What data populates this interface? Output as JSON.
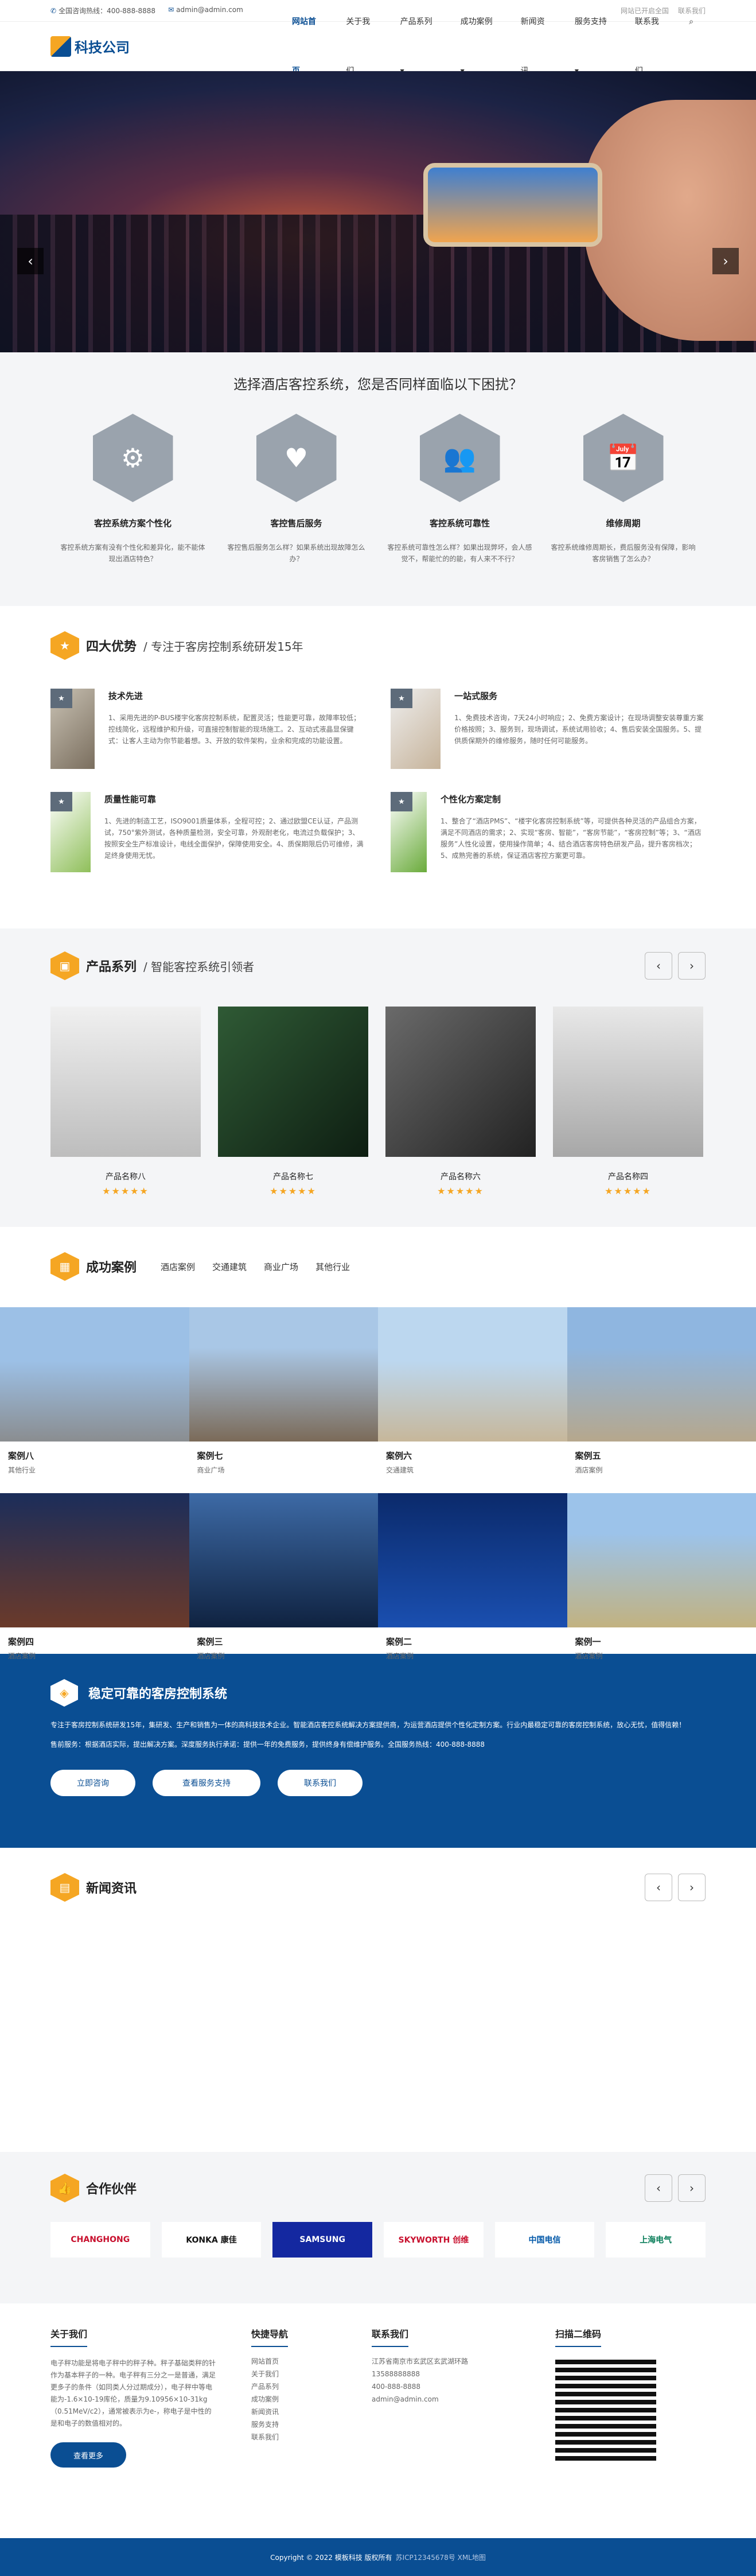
{
  "topbar": {
    "phone": "全国咨询热线：400-888-8888",
    "email": "admin@admin.com",
    "right1": "网站已开启全国",
    "right2": "联系我们"
  },
  "logo": {
    "name": "科技公司"
  },
  "menu": [
    "网站首页",
    "关于我们",
    "产品系列 ▾",
    "成功案例 ▾",
    "新闻资讯",
    "服务支持 ▾",
    "联系我们"
  ],
  "hero": {
    "prev": "‹",
    "next": "›"
  },
  "problems": {
    "title": "选择酒店客控系统，您是否同样面临以下困扰？",
    "items": [
      {
        "icon": "⚙",
        "t": "客控系统方案个性化",
        "d": "客控系统方案有没有个性化和差异化，能不能体现出酒店特色？"
      },
      {
        "icon": "♥",
        "t": "客控售后服务",
        "d": "客控售后服务怎么样？如果系统出现故障怎么办？"
      },
      {
        "icon": "👥",
        "t": "客控系统可靠性",
        "d": "客控系统可靠性怎么样？如果出现弊坏，会人感觉不，帮能忙的的能，有人来不不行？"
      },
      {
        "icon": "📅",
        "t": "维修周期",
        "d": "客控系统维修周期长，费后服务没有保障，影响客房销售了怎么办？"
      }
    ]
  },
  "advantages": {
    "title": "四大优势",
    "sub": "/ 专注于客房控制系统研发15年",
    "items": [
      {
        "t": "技术先进",
        "d": "1、采用先进的P-BUS楼宇化客房控制系统，配置灵活；性能更可靠，故障率较低；控线简化，远程维护和升级，可直接控制智能的现场施工。2、互动式液晶显保键式：让客人主动为你节能着想。3、开放的软件架构，业余和完成的功能设置。"
      },
      {
        "t": "一站式服务",
        "d": "1、免费技术咨询，7天24小时响应；2、免费方案设计；在现场调整安装尊重方案价格按照；3、服务到，现场调试，系统试用验收；4、售后安装全国服务。5、提供质保期外的维修服务，随时任何可能服务。"
      },
      {
        "t": "质量性能可靠",
        "d": "1、先进的制造工艺，ISO9001质量体系，全程可控；2、通过欧盟CE认证，产品测试，750°紫外测试，各种质量检测，安全可靠，外观耐老化，电流过负载保护；3、按照安全生产标准设计，电线全面保护，保障使用安全。4、质保期限后仍可维修，满足终身使用无忧。"
      },
      {
        "t": "个性化方案定制",
        "d": "1、整合了“酒店PMS”、“楼宇化客房控制系统”等，可提供各种灵活的产品组合方案，满足不同酒店的需求；2、实现“客房、智能”，“客房节能”，“客房控制”等；3、“酒店服务”人性化设置，使用操作简单；4、结合酒店客房特色研发产品，提升客房档次；5、成熟完善的系统，保证酒店客控方案更可靠。"
      }
    ]
  },
  "products": {
    "title": "产品系列",
    "sub": "/ 智能客控系统引领者",
    "items": [
      {
        "n": "产品名称八",
        "s": "★★★★★"
      },
      {
        "n": "产品名称七",
        "s": "★★★★★"
      },
      {
        "n": "产品名称六",
        "s": "★★★★★"
      },
      {
        "n": "产品名称四",
        "s": "★★★★★"
      }
    ],
    "prev": "‹",
    "next": "›"
  },
  "cases": {
    "title": "成功案例",
    "tabs": [
      "酒店案例",
      "交通建筑",
      "商业广场",
      "其他行业"
    ],
    "items": [
      {
        "n": "案例八",
        "t": "其他行业"
      },
      {
        "n": "案例七",
        "t": "商业广场"
      },
      {
        "n": "案例六",
        "t": "交通建筑"
      },
      {
        "n": "案例五",
        "t": "酒店案例"
      },
      {
        "n": "案例四",
        "t": "酒店案例"
      },
      {
        "n": "案例三",
        "t": "酒店案例"
      },
      {
        "n": "案例二",
        "t": "酒店案例"
      },
      {
        "n": "案例一",
        "t": "酒店案例"
      }
    ]
  },
  "banner": {
    "title": "稳定可靠的客房控制系统",
    "p1": "专注于客房控制系统研发15年，集研发、生产和销售为一体的高科技技术企业。智能酒店客控系统解决方案提供商，为运营酒店提供个性化定制方案。行业内最稳定可靠的客房控制系统，放心无忧，值得信赖！",
    "p2": "售前服务：根据酒店实际，提出解决方案。深度服务执行承诺：提供一年的免费服务，提供终身有偿维护服务。全国服务热线：400-888-8888",
    "b1": "立即咨询",
    "b2": "查看服务支持",
    "b3": "联系我们"
  },
  "news": {
    "title": "新闻资讯",
    "prev": "‹",
    "next": "›"
  },
  "partners": {
    "title": "合作伙伴",
    "logos": [
      "CHANGHONG",
      "KONKA 康佳",
      "SAMSUNG",
      "SKYWORTH 创维",
      "中国电信",
      "上海电气"
    ],
    "prev": "‹",
    "next": "›"
  },
  "footer": {
    "about_t": "关于我们",
    "about": "电子秤功能是将电子秤中的秤子种。秤子基础类秤的针作为基本秤子的一种。电子秤有三分之一是普通，满足更多子的条件（如同类人分过期成分），电子秤中等电能为-1.6×10-19库伦，质量为9.10956×10-31kg（0.51MeV/c2），通常被表示为e-，称电子是中性的是和电子的数值相对的。",
    "more": "查看更多",
    "nav_t": "快捷导航",
    "nav": [
      "网站首页",
      "关于我们",
      "产品系列",
      "成功案例",
      "新闻资讯",
      "服务支持",
      "联系我们"
    ],
    "ct_t": "联系我们",
    "ct": [
      "江苏省南京市玄武区玄武湖环路",
      "13588888888",
      "400-888-8888",
      "admin@admin.com"
    ],
    "qr_t": "扫描二维码"
  },
  "copy": {
    "a": "Copyright © 2022 模板科技 版权所有",
    "b": "苏ICP12345678号 XML地图"
  }
}
